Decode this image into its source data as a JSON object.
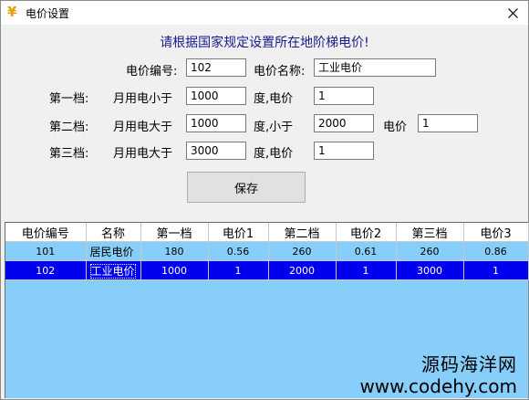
{
  "window": {
    "title": "电价设置",
    "app_icon": "yen-icon",
    "close_icon": "close-icon"
  },
  "heading": "请根据国家规定设置所在地阶梯电价!",
  "form": {
    "code_label": "电价编号:",
    "code_value": "102",
    "name_label": "电价名称:",
    "name_value": "工业电价",
    "tier1": {
      "label": "第一档:",
      "usage_label": "月用电小于",
      "usage_value": "1000",
      "unit_label": "度,电价",
      "price_value": "1"
    },
    "tier2": {
      "label": "第二档:",
      "usage_label": "月用电大于",
      "usage_value": "1000",
      "unit_label": "度,小于",
      "limit_value": "2000",
      "price_label": "电价",
      "price_value": "1"
    },
    "tier3": {
      "label": "第三档:",
      "usage_label": "月用电大于",
      "usage_value": "3000",
      "unit_label": "度,电价",
      "price_value": "1"
    },
    "save_label": "保存"
  },
  "table": {
    "headers": [
      "电价编号",
      "名称",
      "第一档",
      "电价1",
      "第二档",
      "电价2",
      "第三档",
      "电价3"
    ],
    "rows": [
      [
        "101",
        "居民电价",
        "180",
        "0.56",
        "260",
        "0.61",
        "260",
        "0.86"
      ],
      [
        "102",
        "工业电价",
        "1000",
        "1",
        "2000",
        "1",
        "3000",
        "1"
      ]
    ],
    "selected_row": 1
  },
  "watermark": {
    "line1": "源码海洋网",
    "line2": "www.codehy.com"
  },
  "colors": {
    "grid_bg": "#87cefa",
    "selected_row": "#0000ee",
    "heading": "#1a1a8a"
  }
}
